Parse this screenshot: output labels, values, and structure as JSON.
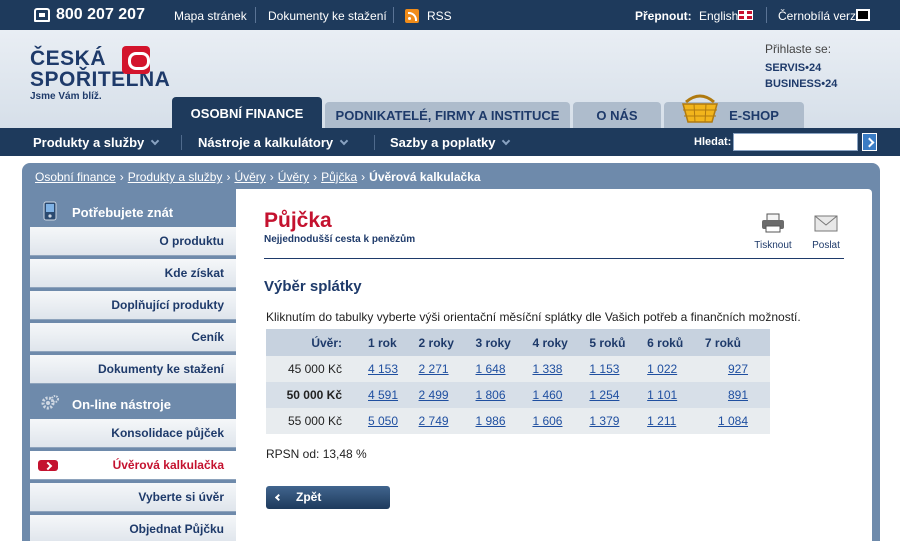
{
  "topbar": {
    "phone": "800 207 207",
    "links": [
      "Mapa stránek",
      "Dokumenty ke stažení",
      "RSS"
    ],
    "switch_label": "Přepnout:",
    "lang": "English",
    "bw_mode": "Černobílá verze"
  },
  "logo": {
    "line1": "ČESKÁ",
    "line2": "SPOŘITELNA",
    "slogan": "Jsme Vám blíž."
  },
  "login": {
    "label": "Přihlaste se:",
    "servis": "SERVIS•24",
    "business": "BUSINESS•24"
  },
  "tabs": [
    "OSOBNÍ FINANCE",
    "PODNIKATELÉ, FIRMY A INSTITUCE",
    "O NÁS",
    "E-SHOP"
  ],
  "nav": {
    "items": [
      "Produkty a služby",
      "Nástroje a kalkulátory",
      "Sazby a poplatky"
    ],
    "search_label": "Hledat:",
    "search_placeholder": ""
  },
  "breadcrumb": {
    "items": [
      "Osobní finance",
      "Produkty a služby",
      "Úvěry",
      "Úvěry",
      "Půjčka"
    ],
    "current": "Úvěrová kalkulačka"
  },
  "sidebar": {
    "section1": "Potřebujete znát",
    "items1": [
      "O produktu",
      "Kde získat",
      "Doplňující produkty",
      "Ceník",
      "Dokumenty ke stažení"
    ],
    "section2": "On-line nástroje",
    "items2": [
      "Konsolidace půjček",
      "Úvěrová kalkulačka",
      "Vyberte si úvěr",
      "Objednat Půjčku"
    ]
  },
  "main": {
    "title": "Půjčka",
    "subtitle": "Nejjednodušší cesta k penězům",
    "print": "Tisknout",
    "send": "Poslat",
    "section": "Výběr splátky",
    "instructions": "Kliknutím do tabulky vyberte výši orientační měsíční splátky dle Vašich potřeb a finančních možností.",
    "table": {
      "headers": [
        "Úvěr:",
        "1 rok",
        "2 roky",
        "3 roky",
        "4 roky",
        "5 roků",
        "6 roků",
        "7 roků"
      ],
      "rows": [
        [
          "45 000 Kč",
          "4 153",
          "2 271",
          "1 648",
          "1 338",
          "1 153",
          "1 022",
          "927"
        ],
        [
          "50 000 Kč",
          "4 591",
          "2 499",
          "1 806",
          "1 460",
          "1 254",
          "1 101",
          "891"
        ],
        [
          "55 000 Kč",
          "5 050",
          "2 749",
          "1 986",
          "1 606",
          "1 379",
          "1 211",
          "1 084"
        ]
      ]
    },
    "rpsn": "RPSN od: 13,48 %",
    "back": "Zpět"
  }
}
